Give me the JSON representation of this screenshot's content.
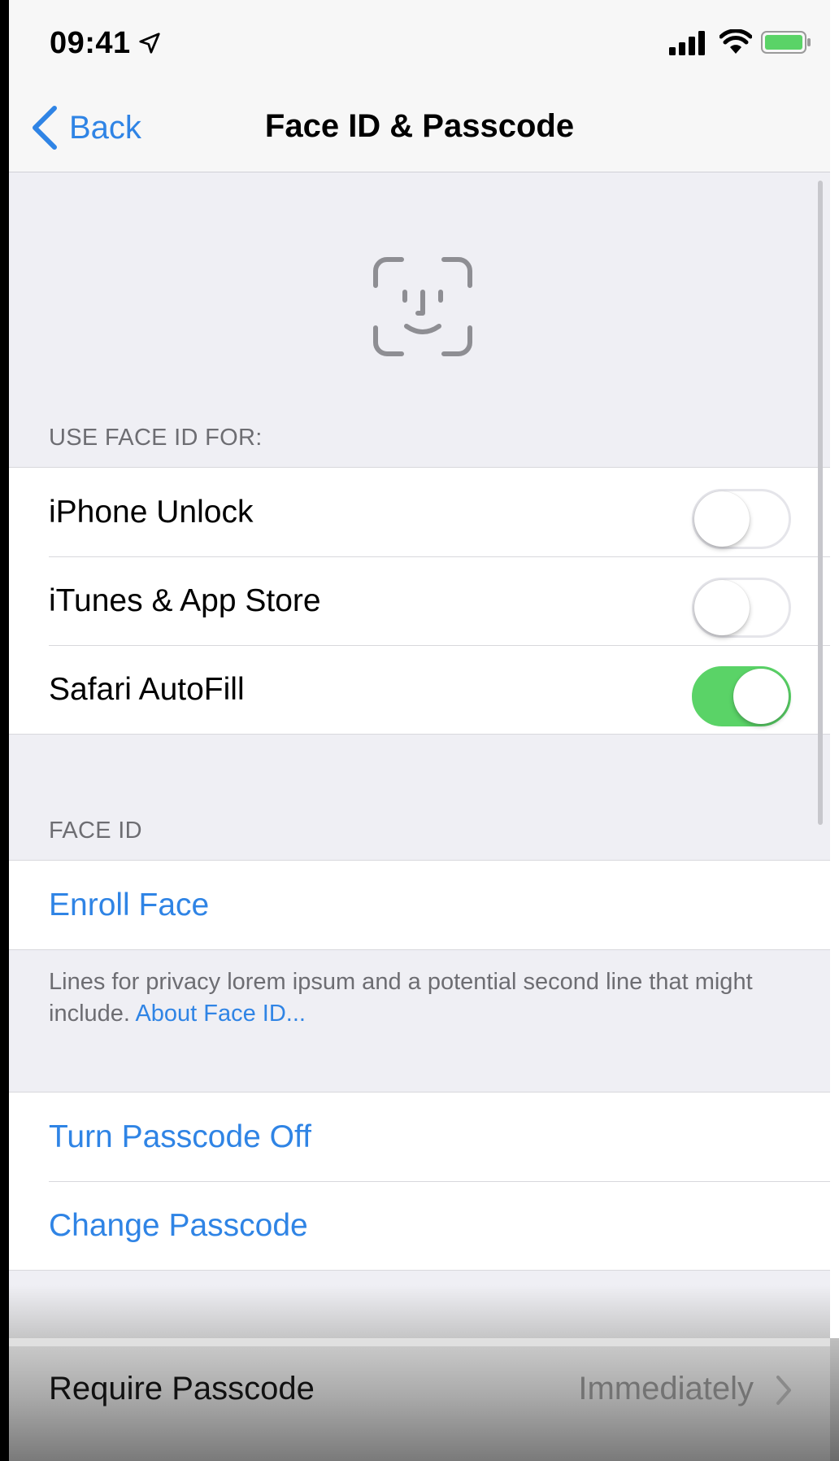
{
  "status_bar": {
    "time": "09:41",
    "icons": [
      "location-arrow-icon",
      "cellular-signal-icon",
      "wifi-icon",
      "battery-icon"
    ]
  },
  "nav": {
    "back_label": "Back",
    "title": "Face ID & Passcode"
  },
  "face_id_section": {
    "header": "USE FACE ID FOR:",
    "items": [
      {
        "label": "iPhone Unlock",
        "enabled": false
      },
      {
        "label": "iTunes & App Store",
        "enabled": false
      },
      {
        "label": "Safari AutoFill",
        "enabled": true
      }
    ]
  },
  "enroll_section": {
    "header": "FACE ID",
    "enroll_label": "Enroll Face",
    "footer_text": "Lines for privacy lorem ipsum and a potential second line that might include.",
    "footer_link": "About Face ID..."
  },
  "passcode_section": {
    "turn_off_label": "Turn Passcode Off",
    "change_label": "Change Passcode"
  },
  "require_passcode": {
    "label": "Require Passcode",
    "value": "Immediately"
  },
  "colors": {
    "accent_blue": "#2f84e5",
    "toggle_on": "#5ad367",
    "background": "#efeff4"
  }
}
